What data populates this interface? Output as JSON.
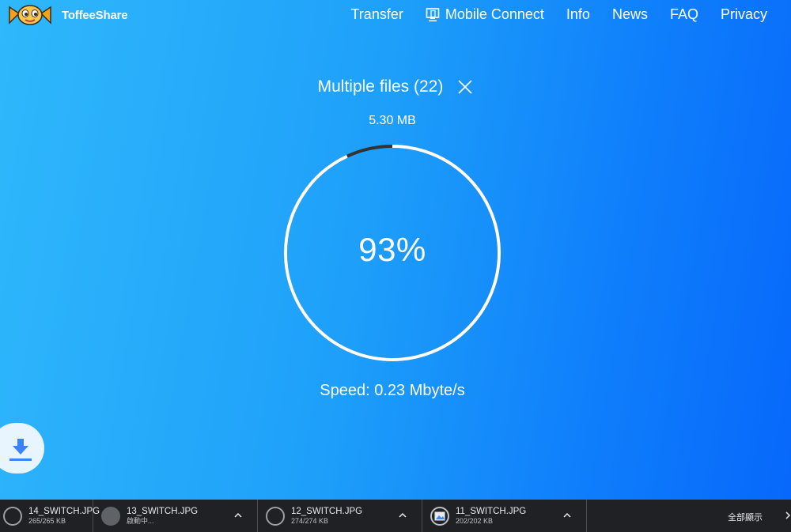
{
  "app": {
    "brand_name": "ToffeeShare",
    "nav": [
      {
        "label": "Transfer"
      },
      {
        "label": "Mobile Connect",
        "icon": "monitor-phone-icon"
      },
      {
        "label": "Info"
      },
      {
        "label": "News"
      },
      {
        "label": "FAQ"
      },
      {
        "label": "Privacy"
      }
    ],
    "colors": {
      "gradient_start": "#2fb8fb",
      "gradient_end": "#0768fb",
      "ring": "#ffffff",
      "ring_progress": "#333333"
    }
  },
  "transfer": {
    "title": "Multiple files (22)",
    "size": "5.30 MB",
    "percent_label": "93%",
    "progress": 0.93,
    "speed": "Speed: 0.23 Mbyte/s"
  },
  "shelf": {
    "items": [
      {
        "name": "14_SWITCH.JPG",
        "status": "265/265 KB",
        "icon": "file-done-icon"
      },
      {
        "name": "13_SWITCH.JPG",
        "status": "啟動中...",
        "icon": "file-pending-icon"
      },
      {
        "name": "12_SWITCH.JPG",
        "status": "274/274 KB",
        "icon": "file-done-icon"
      },
      {
        "name": "11_SWITCH.JPG",
        "status": "202/202 KB",
        "icon": "image-file-icon"
      }
    ],
    "show_all": "全部顯示"
  }
}
